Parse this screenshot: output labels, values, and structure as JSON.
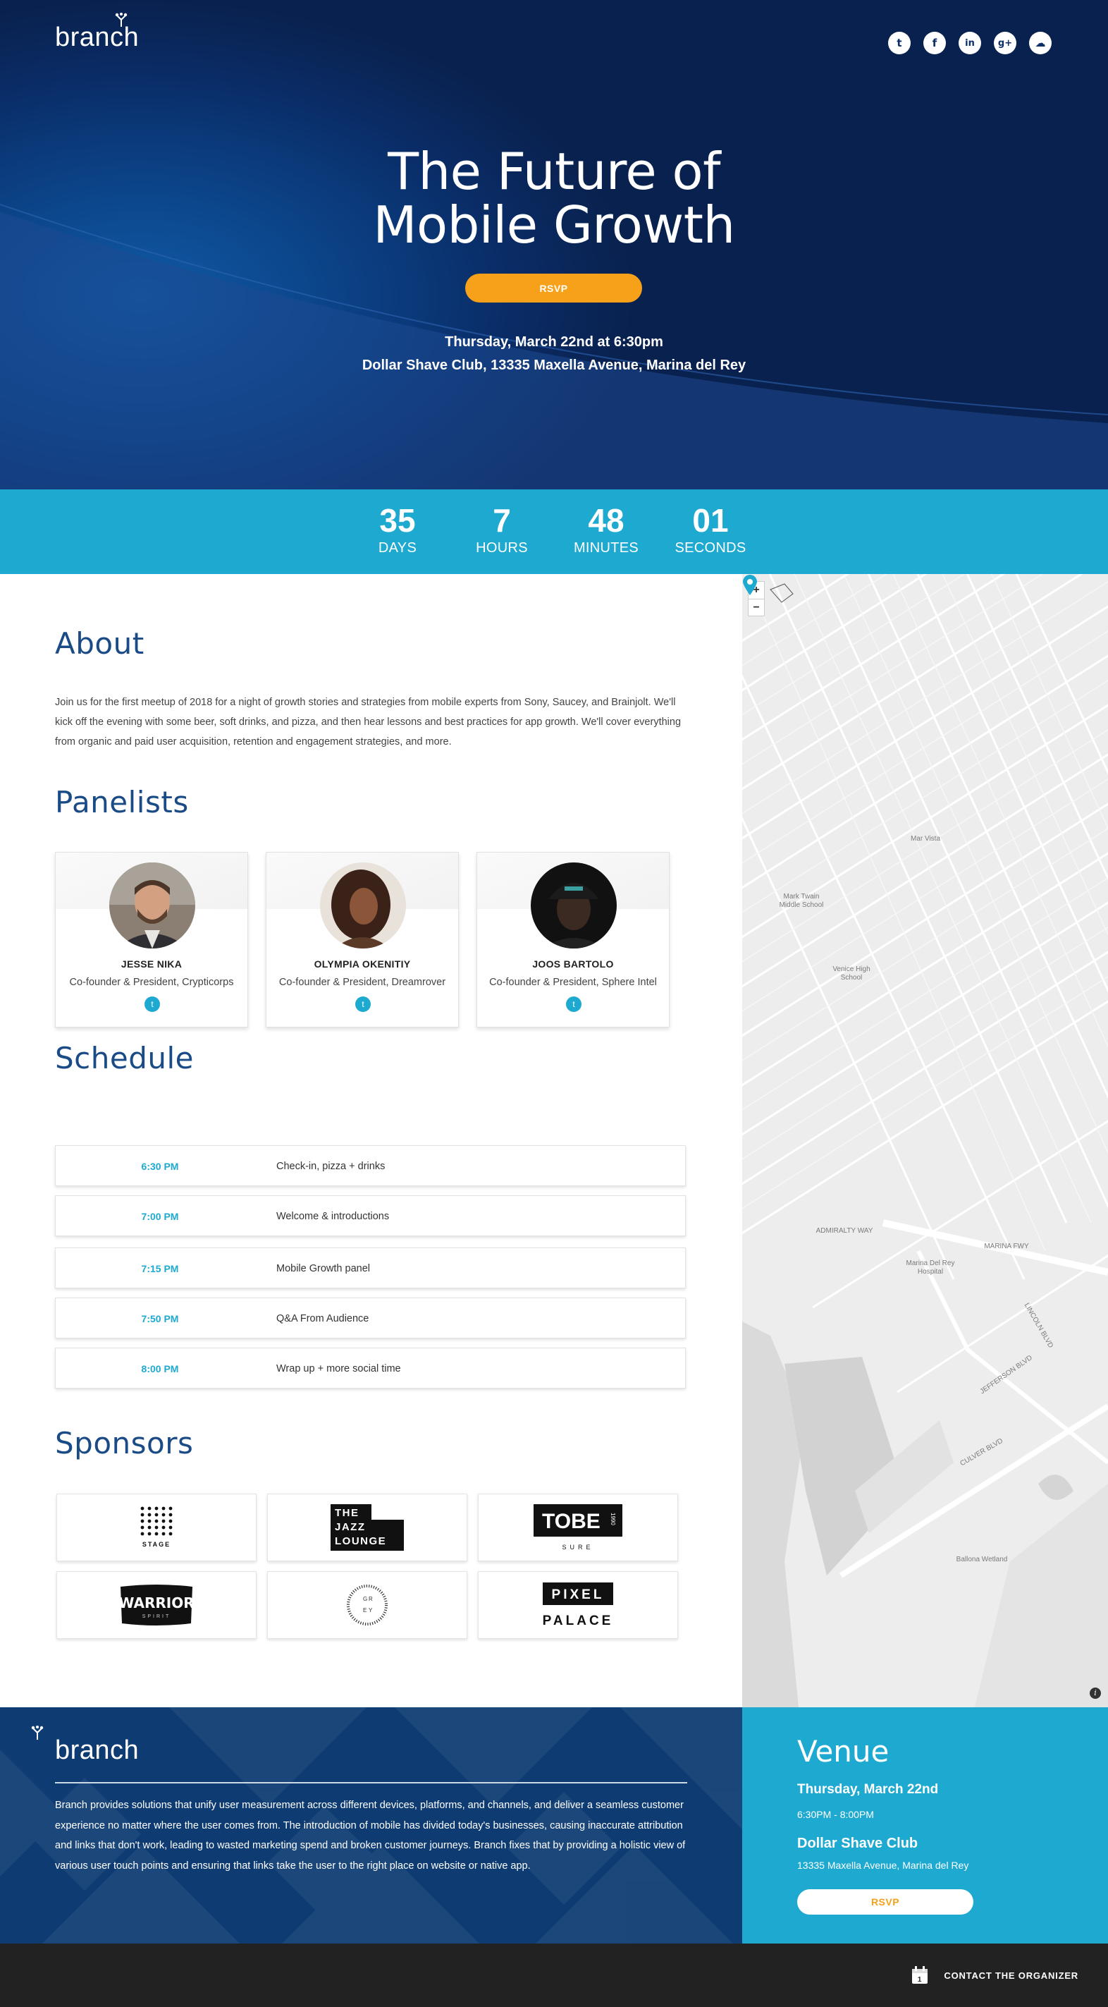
{
  "brand": {
    "name": "branch"
  },
  "social": [
    {
      "name": "twitter-icon",
      "glyph": "t"
    },
    {
      "name": "facebook-icon",
      "glyph": "f"
    },
    {
      "name": "linkedin-icon",
      "glyph": "in"
    },
    {
      "name": "google-plus-icon",
      "glyph": "g+"
    },
    {
      "name": "soundcloud-icon",
      "glyph": "☁"
    }
  ],
  "hero": {
    "title_line1": "The Future of",
    "title_line2": "Mobile Growth",
    "rsvp_label": "RSVP",
    "date": "Thursday, March 22nd at 6:30pm",
    "location": "Dollar Shave Club, 13335 Maxella Avenue, Marina del Rey"
  },
  "countdown": {
    "days": "35",
    "days_label": "DAYS",
    "hours": "7",
    "hours_label": "HOURS",
    "minutes": "48",
    "minutes_label": "MINUTES",
    "seconds": "01",
    "seconds_label": "SECONDS"
  },
  "about": {
    "title": "About",
    "text": "Join us for the first meetup of 2018 for a night of growth stories and strategies from mobile experts from Sony, Saucey, and Brainjolt. We'll kick off the evening with some beer, soft drinks, and pizza, and then hear lessons and best practices for app growth. We'll cover everything from organic and paid user acquisition, retention and engagement strategies, and more."
  },
  "panelists": {
    "title": "Panelists",
    "items": [
      {
        "name": "JESSE NIKA",
        "role": "Co-founder & President, Crypticorps"
      },
      {
        "name": "OLYMPIA OKENITIY",
        "role": "Co-founder & President, Dreamrover"
      },
      {
        "name": "JOOS BARTOLO",
        "role": "Co-founder & President, Sphere Intel"
      }
    ]
  },
  "schedule": {
    "title": "Schedule",
    "items": [
      {
        "time": "6:30 PM",
        "desc": "Check-in, pizza + drinks"
      },
      {
        "time": "7:00 PM",
        "desc": "Welcome & introductions"
      },
      {
        "time": "7:15 PM",
        "desc": "Mobile Growth panel"
      },
      {
        "time": "7:50 PM",
        "desc": "Q&A From Audience"
      },
      {
        "time": "8:00 PM",
        "desc": "Wrap up + more social time"
      }
    ]
  },
  "sponsors": {
    "title": "Sponsors",
    "stage": "STAGE",
    "jazz": [
      "THE",
      "JAZZ",
      "LOUNGE"
    ],
    "tobe": "TOBE",
    "tobe_year": "1990",
    "tobe_sub": "SURE",
    "warrior": "WARRIOR",
    "warrior_sub": "SPIRIT",
    "grey": [
      "G",
      "R",
      "E",
      "Y"
    ],
    "pixel": "PIXEL",
    "palace": "PALACE"
  },
  "map": {
    "zoom_in": "+",
    "zoom_out": "−",
    "labels": {
      "mark_twain": "Mark Twain Middle School",
      "venice_high": "Venice High School",
      "marina_hospital": "Marina Del Rey Hospital",
      "mar_vista": "Mar Vista",
      "ballona": "Ballona Wetland",
      "marina_fwy": "MARINA FWY",
      "admiralty": "ADMIRALTY WAY",
      "lincoln": "LINCOLN BLVD",
      "culver": "CULVER BLVD",
      "jefferson": "JEFFERSON BLVD"
    },
    "info": "i"
  },
  "footer": {
    "brand": "branch",
    "text": "Branch provides solutions that unify user measurement across different devices, platforms, and channels, and deliver a seamless customer experience no matter where the user comes from. The introduction of mobile has divided today's businesses, causing inaccurate attribution and links that don't work, leading to wasted marketing spend and broken customer journeys. Branch fixes that by providing a holistic view of various user touch points and ensuring that links take the user to the right place on website or native app."
  },
  "venue": {
    "title": "Venue",
    "date": "Thursday, March 22nd",
    "time": "6:30PM - 8:00PM",
    "name": "Dollar Shave Club",
    "address": "13335 Maxella Avenue, Marina del Rey",
    "rsvp_label": "RSVP"
  },
  "contact": {
    "label": "CONTACT THE ORGANIZER",
    "cal_day": "1"
  },
  "colors": {
    "navy": "#0a2c66",
    "accent": "#1ea9d1",
    "orange": "#f7a11a",
    "dark": "#222222"
  }
}
